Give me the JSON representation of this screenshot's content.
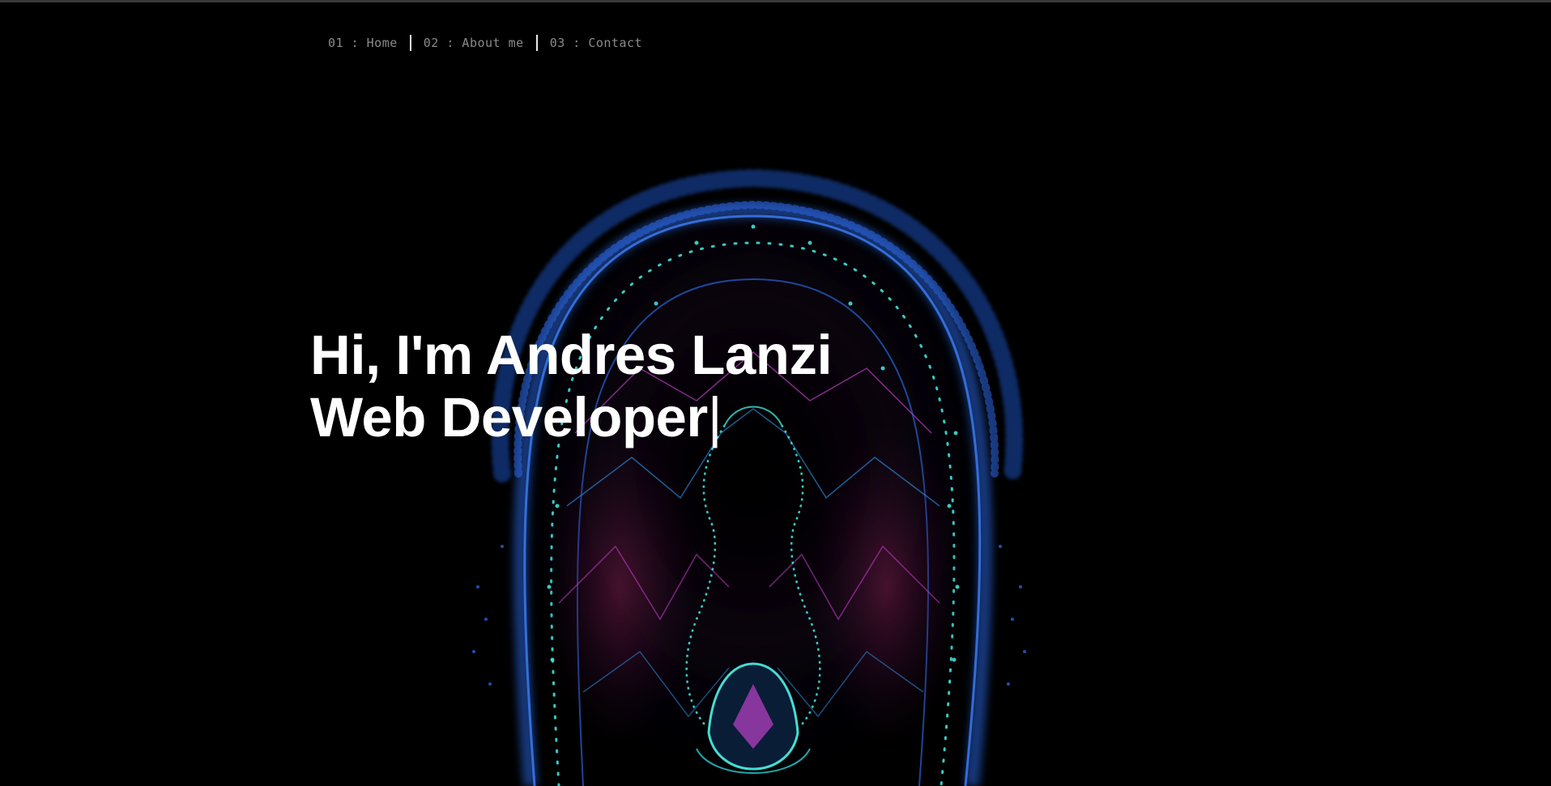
{
  "nav": {
    "items": [
      {
        "label": "01 : Home"
      },
      {
        "label": "02 : About me"
      },
      {
        "label": "03 : Contact"
      }
    ]
  },
  "hero": {
    "line1": "Hi, I'm Andres Lanzi",
    "line2": "Web Developer",
    "cursor": "|",
    "image_icon": "particle-face-icon"
  },
  "colors": {
    "background": "#000000",
    "nav_text": "#8a8a8a",
    "headline": "#ffffff",
    "accent_blue": "#2a63d8",
    "accent_cyan": "#3fe0d8",
    "accent_magenta": "#c03cc8"
  }
}
